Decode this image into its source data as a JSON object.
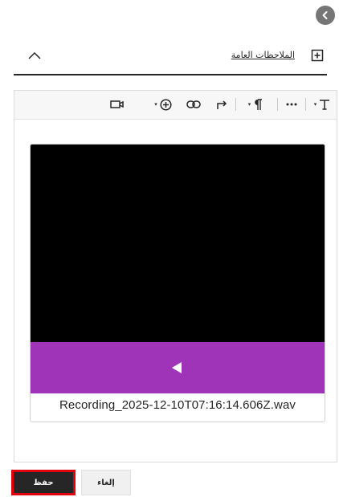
{
  "header": {
    "back_icon": "chevron-left-icon",
    "section_title": "الملاحظات العامة",
    "collapse_icon": "chevron-up-icon",
    "add_note_icon": "plus-square-icon"
  },
  "toolbar": {
    "items": [
      "text-style-icon",
      "more-icon",
      "paragraph-icon",
      "redo-icon",
      "undo-icon",
      "link-icon",
      "insert-icon",
      "video-icon"
    ]
  },
  "attachment": {
    "file_name": "Recording_2025-12-10T07:16:14.606Z.wav",
    "accent_color": "#a034b8",
    "play_icon": "play-icon"
  },
  "footer": {
    "save_label": "حفظ",
    "cancel_label": "إلغاء"
  }
}
